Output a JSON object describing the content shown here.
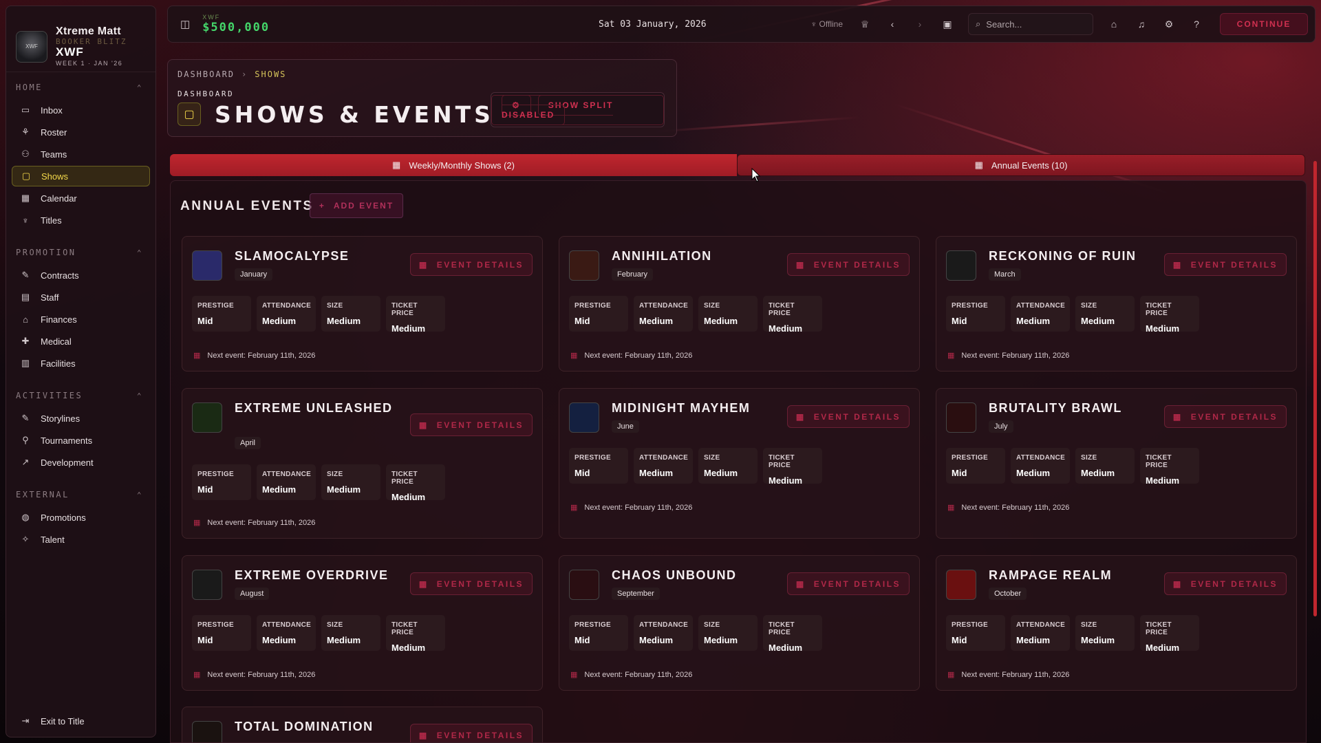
{
  "sidebar": {
    "brand": {
      "name": "Xtreme Matt",
      "subtitle": "BOOKER BLITZ",
      "promotion": "XWF",
      "week": "WEEK 1 · JAN '26",
      "logo_text": "XWF"
    },
    "sections": [
      {
        "title": "HOME",
        "items": [
          {
            "label": "Inbox",
            "icon": "inbox-icon",
            "glyph": "▭"
          },
          {
            "label": "Roster",
            "icon": "roster-icon",
            "glyph": "⚘"
          },
          {
            "label": "Teams",
            "icon": "users-icon",
            "glyph": "⚇"
          },
          {
            "label": "Shows",
            "icon": "tv-icon",
            "glyph": "▢",
            "active": true
          },
          {
            "label": "Calendar",
            "icon": "calendar-icon",
            "glyph": "▦"
          },
          {
            "label": "Titles",
            "icon": "trophy-icon",
            "glyph": "♆"
          }
        ]
      },
      {
        "title": "PROMOTION",
        "items": [
          {
            "label": "Contracts",
            "icon": "contract-icon",
            "glyph": "✎"
          },
          {
            "label": "Staff",
            "icon": "briefcase-icon",
            "glyph": "▤"
          },
          {
            "label": "Finances",
            "icon": "bank-icon",
            "glyph": "⌂"
          },
          {
            "label": "Medical",
            "icon": "medical-icon",
            "glyph": "✚"
          },
          {
            "label": "Facilities",
            "icon": "building-icon",
            "glyph": "▥"
          }
        ]
      },
      {
        "title": "ACTIVITIES",
        "items": [
          {
            "label": "Storylines",
            "icon": "storyline-icon",
            "glyph": "✎"
          },
          {
            "label": "Tournaments",
            "icon": "bracket-icon",
            "glyph": "⚲"
          },
          {
            "label": "Development",
            "icon": "trend-icon",
            "glyph": "↗"
          }
        ]
      },
      {
        "title": "EXTERNAL",
        "items": [
          {
            "label": "Promotions",
            "icon": "globe-icon",
            "glyph": "◍"
          },
          {
            "label": "Talent",
            "icon": "talent-icon",
            "glyph": "✧"
          }
        ]
      }
    ],
    "exit_label": "Exit to Title"
  },
  "topbar": {
    "money_label": "XWF",
    "money": "$500,000",
    "date": "Sat 03 January, 2026",
    "offline": "Offline",
    "search_placeholder": "Search...",
    "continue_label": "CONTINUE"
  },
  "header": {
    "breadcrumb": [
      "DASHBOARD",
      "SHOWS"
    ],
    "label": "DASHBOARD",
    "title": "SHOWS & EVENTS",
    "split_button": "SHOW SPLIT DISABLED"
  },
  "tabs": [
    {
      "label": "Weekly/Monthly Shows (2)"
    },
    {
      "label": "Annual Events (10)"
    }
  ],
  "annual": {
    "title": "ANNUAL EVENTS",
    "add_label": "ADD EVENT",
    "details_label": "EVENT DETAILS",
    "stat_labels": [
      "PRESTIGE",
      "ATTENDANCE",
      "SIZE",
      "TICKET PRICE"
    ],
    "events": [
      {
        "name": "SLAMOCALYPSE",
        "month": "January",
        "prestige": "Mid",
        "attendance": "Medium",
        "size": "Medium",
        "ticket": "Medium",
        "next": "Next event: February 11th, 2026",
        "logo_color": "#2a2a6a"
      },
      {
        "name": "ANNIHILATION",
        "month": "February",
        "prestige": "Mid",
        "attendance": "Medium",
        "size": "Medium",
        "ticket": "Medium",
        "next": "Next event: February 11th, 2026",
        "logo_color": "#3a1a14"
      },
      {
        "name": "RECKONING OF RUIN",
        "month": "March",
        "prestige": "Mid",
        "attendance": "Medium",
        "size": "Medium",
        "ticket": "Medium",
        "next": "Next event: February 11th, 2026",
        "logo_color": "#1a1a1a"
      },
      {
        "name": "EXTREME UNLEASHED",
        "month": "April",
        "prestige": "Mid",
        "attendance": "Medium",
        "size": "Medium",
        "ticket": "Medium",
        "next": "Next event: February 11th, 2026",
        "logo_color": "#1a2a14"
      },
      {
        "name": "MIDINIGHT MAYHEM",
        "month": "June",
        "prestige": "Mid",
        "attendance": "Medium",
        "size": "Medium",
        "ticket": "Medium",
        "next": "Next event: February 11th, 2026",
        "logo_color": "#142040"
      },
      {
        "name": "BRUTALITY BRAWL",
        "month": "July",
        "prestige": "Mid",
        "attendance": "Medium",
        "size": "Medium",
        "ticket": "Medium",
        "next": "Next event: February 11th, 2026",
        "logo_color": "#2a0e10"
      },
      {
        "name": "EXTREME OVERDRIVE",
        "month": "August",
        "prestige": "Mid",
        "attendance": "Medium",
        "size": "Medium",
        "ticket": "Medium",
        "next": "Next event: February 11th, 2026",
        "logo_color": "#1a1a1a"
      },
      {
        "name": "CHAOS UNBOUND",
        "month": "September",
        "prestige": "Mid",
        "attendance": "Medium",
        "size": "Medium",
        "ticket": "Medium",
        "next": "Next event: February 11th, 2026",
        "logo_color": "#2a0e12"
      },
      {
        "name": "RAMPAGE REALM",
        "month": "October",
        "prestige": "Mid",
        "attendance": "Medium",
        "size": "Medium",
        "ticket": "Medium",
        "next": "Next event: February 11th, 2026",
        "logo_color": "#6a1010"
      },
      {
        "name": "TOTAL DOMINATION",
        "month": "",
        "prestige": "",
        "attendance": "",
        "size": "",
        "ticket": "",
        "next": "",
        "logo_color": "#1a1210"
      }
    ]
  }
}
